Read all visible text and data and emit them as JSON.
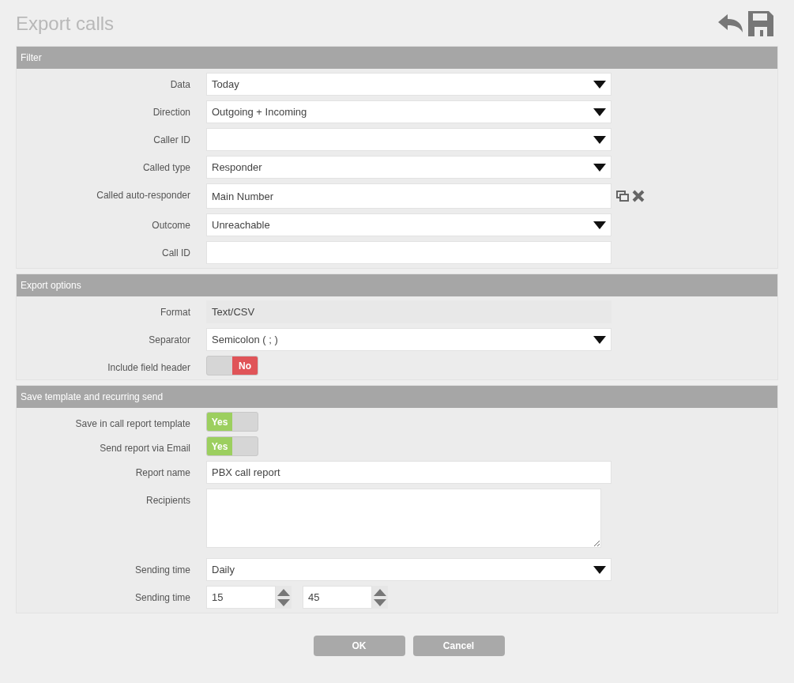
{
  "title": "Export calls",
  "sections": [
    {
      "title": "Filter",
      "rows": [
        {
          "kind": "select",
          "label": "Data",
          "value": "Today"
        },
        {
          "kind": "select",
          "label": "Direction",
          "value": "Outgoing + Incoming"
        },
        {
          "kind": "select",
          "label": "Caller ID"
        },
        {
          "kind": "select",
          "label": "Called type",
          "value": "Responder"
        },
        {
          "kind": "lookup",
          "label": "Called auto-responder",
          "value": "Main Number"
        },
        {
          "kind": "select",
          "label": "Outcome",
          "value": "Unreachable"
        },
        {
          "kind": "text",
          "label": "Call ID"
        }
      ]
    },
    {
      "title": "Export options",
      "rows": [
        {
          "kind": "readonly",
          "label": "Format",
          "value": "Text/CSV"
        },
        {
          "kind": "select",
          "label": "Separator",
          "value": "Semicolon ( ; )"
        },
        {
          "kind": "toggle",
          "label": "Include field header",
          "on": false,
          "value": "No"
        }
      ]
    },
    {
      "title": "Save template and recurring send",
      "rows": [
        {
          "kind": "toggle",
          "label": "Save in call report template",
          "on": true,
          "value": "Yes"
        },
        {
          "kind": "toggle",
          "label": "Send report via Email",
          "on": true,
          "value": "Yes"
        },
        {
          "kind": "text",
          "label": "Report name",
          "value": "PBX call report"
        },
        {
          "kind": "textarea",
          "label": "Recipients"
        },
        {
          "kind": "select",
          "label": "Sending time",
          "value": "Daily"
        },
        {
          "kind": "time",
          "label": "Sending time",
          "hours": "15",
          "minutes": "45"
        }
      ]
    }
  ],
  "buttons": [
    "OK",
    "Cancel"
  ]
}
